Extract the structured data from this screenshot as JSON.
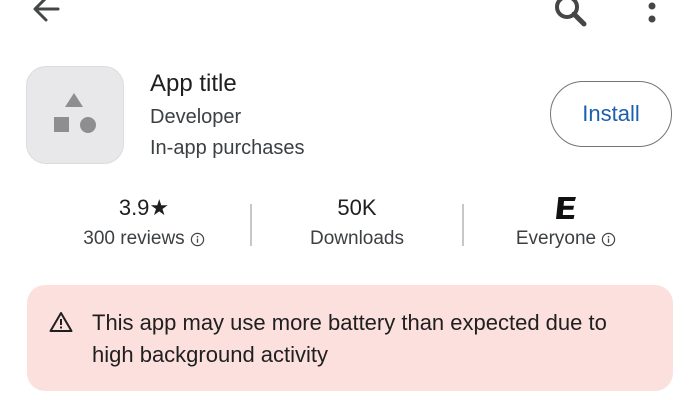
{
  "top_bar": {
    "back_icon": "arrow-back-icon",
    "search_icon": "search-icon",
    "more_icon": "more-vert-icon"
  },
  "app": {
    "icon": "app-placeholder-shapes-icon",
    "title": "App title",
    "developer": "Developer",
    "in_app_purchases": "In-app purchases",
    "install_label": "Install"
  },
  "stats": {
    "rating": {
      "value": "3.9",
      "star": "★",
      "label": "300 reviews"
    },
    "downloads": {
      "value": "50K",
      "label": "Downloads"
    },
    "content_rating": {
      "badge": "E",
      "label": "Everyone"
    }
  },
  "warning": {
    "icon": "warning-triangle-icon",
    "text": "This app may use more battery than expected due to high background activity"
  },
  "colors": {
    "accent": "#1b5fb0",
    "warning_bg": "#fbe0de",
    "icon_bg": "#e8e8ea"
  }
}
